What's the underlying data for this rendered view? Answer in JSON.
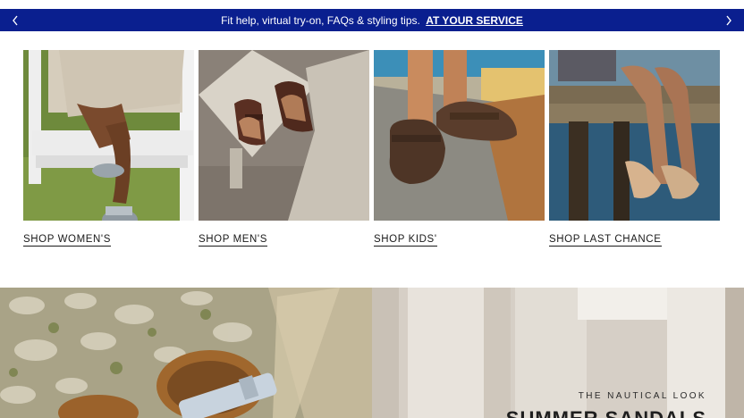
{
  "promo": {
    "text": "Fit help, virtual try-on, FAQs & styling tips.",
    "link": "AT YOUR SERVICE",
    "prev_icon": "chevron-left-icon",
    "next_icon": "chevron-right-icon"
  },
  "categories": [
    {
      "label": "SHOP WOMEN'S"
    },
    {
      "label": "SHOP MEN'S"
    },
    {
      "label": "SHOP KIDS'"
    },
    {
      "label": "SHOP LAST CHANCE"
    }
  ],
  "hero": {
    "eyebrow": "THE NAUTICAL LOOK",
    "headline": "SUMMER SANDALS"
  },
  "colors": {
    "promo_bar": "#0a1f8f",
    "text": "#1a1a1a"
  }
}
